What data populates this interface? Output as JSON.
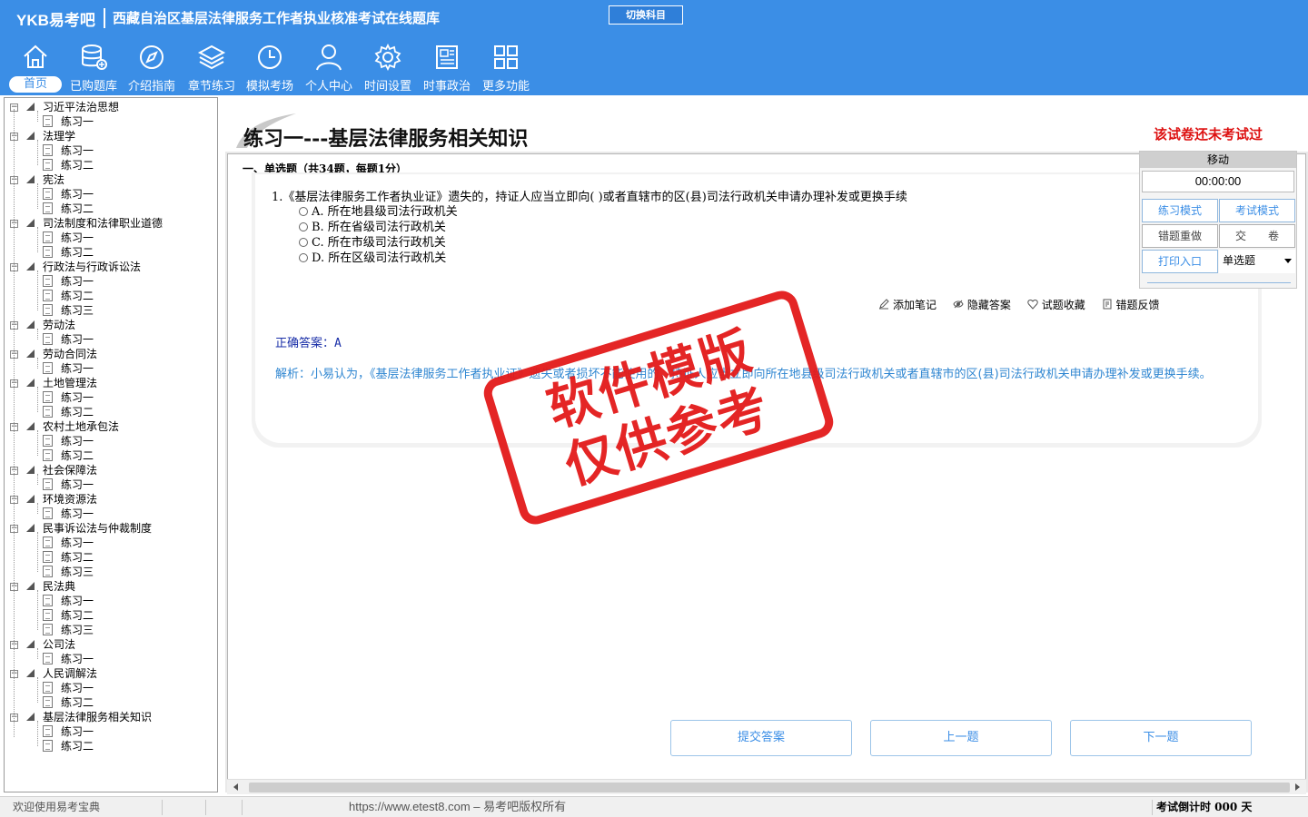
{
  "header": {
    "brand": "YKB易考吧",
    "title": "西藏自治区基层法律服务工作者执业核准考试在线题库",
    "switch_label": "切换科目",
    "nav": [
      {
        "label": "首页",
        "icon": "home-icon",
        "active": true
      },
      {
        "label": "已购题库",
        "icon": "database-icon"
      },
      {
        "label": "介绍指南",
        "icon": "compass-icon"
      },
      {
        "label": "章节练习",
        "icon": "layers-icon"
      },
      {
        "label": "模拟考场",
        "icon": "clock-icon"
      },
      {
        "label": "个人中心",
        "icon": "user-icon"
      },
      {
        "label": "时间设置",
        "icon": "gear-icon"
      },
      {
        "label": "时事政治",
        "icon": "newspaper-icon"
      },
      {
        "label": "更多功能",
        "icon": "grid-icon"
      }
    ]
  },
  "tree": [
    {
      "label": "习近平法治思想",
      "children": [
        "练习一"
      ]
    },
    {
      "label": "法理学",
      "children": [
        "练习一",
        "练习二"
      ]
    },
    {
      "label": "宪法",
      "children": [
        "练习一",
        "练习二"
      ]
    },
    {
      "label": "司法制度和法律职业道德",
      "children": [
        "练习一",
        "练习二"
      ]
    },
    {
      "label": "行政法与行政诉讼法",
      "children": [
        "练习一",
        "练习二",
        "练习三"
      ]
    },
    {
      "label": "劳动法",
      "children": [
        "练习一"
      ]
    },
    {
      "label": "劳动合同法",
      "children": [
        "练习一"
      ]
    },
    {
      "label": "土地管理法",
      "children": [
        "练习一",
        "练习二"
      ]
    },
    {
      "label": "农村土地承包法",
      "children": [
        "练习一",
        "练习二"
      ]
    },
    {
      "label": "社会保障法",
      "children": [
        "练习一"
      ]
    },
    {
      "label": "环境资源法",
      "children": [
        "练习一"
      ]
    },
    {
      "label": "民事诉讼法与仲裁制度",
      "children": [
        "练习一",
        "练习二",
        "练习三"
      ]
    },
    {
      "label": "民法典",
      "children": [
        "练习一",
        "练习二",
        "练习三"
      ]
    },
    {
      "label": "公司法",
      "children": [
        "练习一"
      ]
    },
    {
      "label": "人民调解法",
      "children": [
        "练习一",
        "练习二"
      ]
    },
    {
      "label": "基层法律服务相关知识",
      "children": [
        "练习一",
        "练习二"
      ]
    }
  ],
  "main": {
    "paper_title": "练习一---基层法律服务相关知识",
    "status": "该试卷还未考试过",
    "section": "一、单选题（共34题，每题1分）",
    "question": {
      "stem": "1.《基层法律服务工作者执业证》遗失的，持证人应当立即向( )或者直辖市的区(县)司法行政机关申请办理补发或更换手续",
      "options": [
        "A. 所在地县级司法行政机关",
        "B. 所在省级司法行政机关",
        "C. 所在市级司法行政机关",
        "D. 所在区级司法行政机关"
      ]
    },
    "tools": [
      "添加笔记",
      "隐藏答案",
      "试题收藏",
      "错题反馈"
    ],
    "answer_label": "正确答案：",
    "answer_value": "A",
    "analysis": "解析：小易认为，《基层法律服务工作者执业证》遗失或者损坏不能使用的，持证人应当立即向所在地县级司法行政机关或者直辖市的区(县)司法行政机关申请办理补发或更换手续。",
    "buttons": {
      "submit": "提交答案",
      "prev": "上一题",
      "next": "下一题"
    }
  },
  "panel": {
    "move": "移动",
    "timer": "00:00:00",
    "practice_mode": "练习模式",
    "exam_mode": "考试模式",
    "redo_wrong": "错题重做",
    "hand_in": "交　　卷",
    "print": "打印入口",
    "type_select": "单选题"
  },
  "watermark": {
    "line1": "软件模版",
    "line2": "仅供参考"
  },
  "status_bar": {
    "welcome": "欢迎使用易考宝典",
    "url": "https://www.etest8.com – 易考吧版权所有",
    "countdown": "考试倒计时 000 天"
  }
}
